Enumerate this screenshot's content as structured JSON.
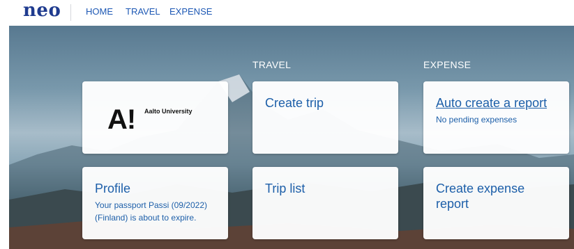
{
  "brand": {
    "logo_text": "neo"
  },
  "nav": {
    "home": "HOME",
    "travel": "TRAVEL",
    "expense": "EXPENSE"
  },
  "columns": {
    "travel": "TRAVEL",
    "expense": "EXPENSE"
  },
  "cards": {
    "org": {
      "logo_mark": "A!",
      "name": "Aalto University"
    },
    "profile": {
      "title": "Profile",
      "message": "Your passport Passi (09/2022) (Finland) is about to expire."
    },
    "create_trip": {
      "title": "Create trip"
    },
    "trip_list": {
      "title": "Trip list"
    },
    "auto_report": {
      "title": "Auto create a report",
      "subtitle": "No pending expenses"
    },
    "create_expense": {
      "title": "Create expense report"
    }
  },
  "colors": {
    "brand": "#1f3b8f",
    "link": "#1d58b4",
    "card_text": "#1d5fa9"
  }
}
